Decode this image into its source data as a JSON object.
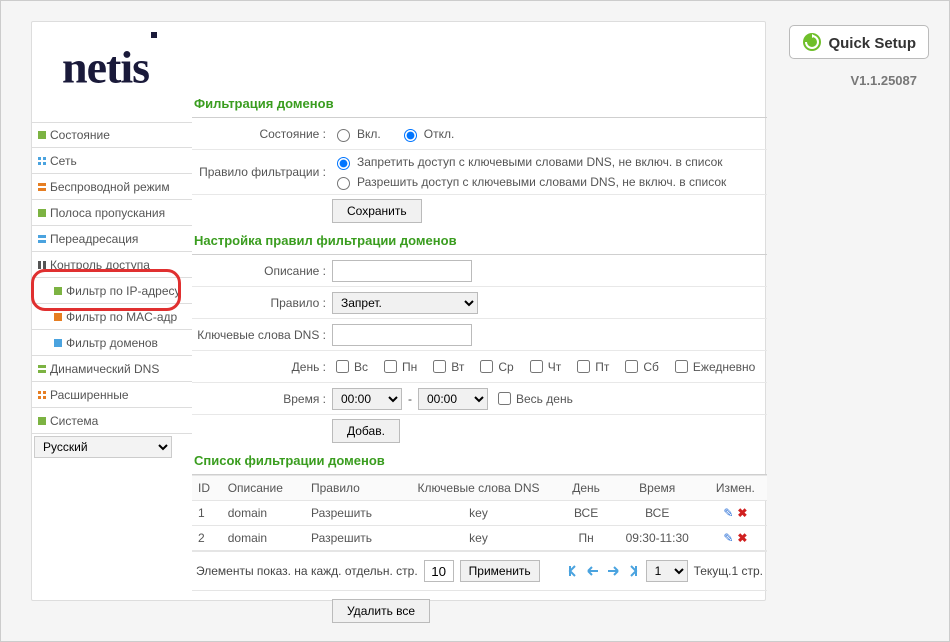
{
  "brand": "netis",
  "quick_setup_label": "Quick Setup",
  "version": "V1.1.25087",
  "sidebar": {
    "items": [
      {
        "label": "Состояние"
      },
      {
        "label": "Сеть"
      },
      {
        "label": "Беспроводной режим"
      },
      {
        "label": "Полоса пропускания"
      },
      {
        "label": "Переадресация"
      },
      {
        "label": "Контроль доступа"
      },
      {
        "label": "Фильтр по IP-адресу",
        "sub": true
      },
      {
        "label": "Фильтр по MAC-адр",
        "sub": true
      },
      {
        "label": "Фильтр доменов",
        "sub": true
      },
      {
        "label": "Динамический DNS"
      },
      {
        "label": "Расширенные"
      },
      {
        "label": "Система"
      }
    ],
    "language": "Русский"
  },
  "sections": {
    "filtering_title": "Фильтрация доменов",
    "state_label": "Состояние :",
    "on_label": "Вкл.",
    "off_label": "Откл.",
    "rule_label": "Правило фильтрации :",
    "rule_deny": "Запретить доступ с ключевыми словами DNS, не включ. в список",
    "rule_allow": "Разрешить доступ с ключевыми словами DNS, не включ. в список",
    "save_btn": "Сохранить",
    "config_title": "Настройка правил фильтрации доменов",
    "desc_label": "Описание :",
    "rule2_label": "Правило :",
    "rule2_value": "Запрет.",
    "dnskw_label": "Ключевые слова DNS :",
    "day_label": "День :",
    "days": [
      "Вс",
      "Пн",
      "Вт",
      "Ср",
      "Чт",
      "Пт",
      "Сб",
      "Ежедневно"
    ],
    "time_label": "Время :",
    "time_from": "00:00",
    "time_sep": "-",
    "time_to": "00:00",
    "all_day": "Весь день",
    "add_btn": "Добав.",
    "list_title": "Список фильтрации доменов",
    "headers": {
      "id": "ID",
      "desc": "Описание",
      "rule": "Правило",
      "dns": "Ключевые слова DNS",
      "day": "День",
      "time": "Время",
      "mod": "Измен."
    },
    "rows": [
      {
        "id": "1",
        "desc": "domain",
        "rule": "Разрешить",
        "dns": "key",
        "day": "ВСЕ",
        "time": "ВСЕ"
      },
      {
        "id": "2",
        "desc": "domain",
        "rule": "Разрешить",
        "dns": "key",
        "day": "Пн",
        "time": "09:30-11:30"
      }
    ],
    "pager_text": "Элементы показ. на кажд. отдельн. стр.",
    "pager_value": "10",
    "apply_btn": "Применить",
    "page_select": "1",
    "cur_page_text": "Текущ.1 стр.",
    "delete_all": "Удалить все"
  }
}
